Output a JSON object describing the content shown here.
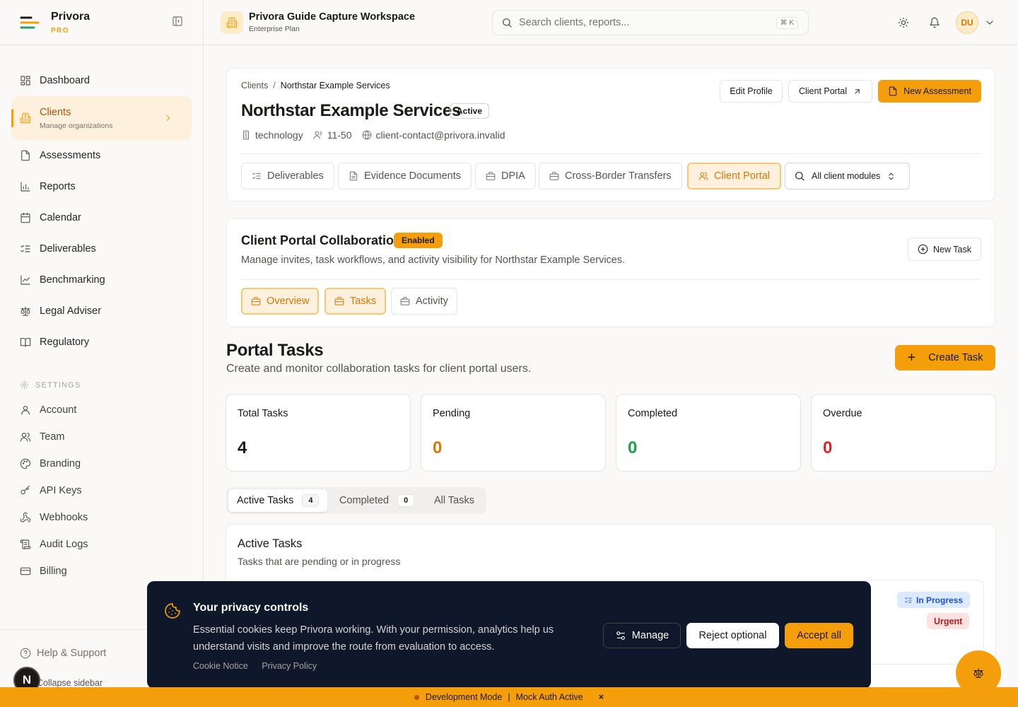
{
  "app": {
    "name": "Privora",
    "tier": "PRO"
  },
  "sidebar": {
    "items": [
      {
        "label": "Dashboard"
      },
      {
        "label": "Clients",
        "sub": "Manage organizations"
      },
      {
        "label": "Assessments"
      },
      {
        "label": "Reports"
      },
      {
        "label": "Calendar"
      },
      {
        "label": "Deliverables"
      },
      {
        "label": "Benchmarking"
      },
      {
        "label": "Legal Adviser"
      },
      {
        "label": "Regulatory"
      }
    ],
    "settings_heading": "SETTINGS",
    "settings": [
      {
        "label": "Account"
      },
      {
        "label": "Team"
      },
      {
        "label": "Branding"
      },
      {
        "label": "API Keys"
      },
      {
        "label": "Webhooks"
      },
      {
        "label": "Audit Logs"
      },
      {
        "label": "Billing"
      }
    ],
    "help": "Help & Support",
    "collapse": "Collapse sidebar",
    "n_badge": "N"
  },
  "topbar": {
    "workspace": "Privora Guide Capture Workspace",
    "plan": "Enterprise Plan",
    "search_placeholder": "Search clients, reports...",
    "shortcut": "⌘ K",
    "avatar": "DU"
  },
  "client": {
    "breadcrumb": [
      "Clients",
      "/",
      "Northstar Example Services"
    ],
    "name": "Northstar Example Services",
    "status": "Active",
    "industry": "technology",
    "size": "11-50",
    "email": "client-contact@privora.invalid",
    "buttons": {
      "edit": "Edit Profile",
      "portal": "Client Portal",
      "new_assessment": "New Assessment"
    },
    "tabs": [
      "Deliverables",
      "Evidence Documents",
      "DPIA",
      "Cross-Border Transfers",
      "Client Portal"
    ],
    "module_select": "All client modules"
  },
  "collab": {
    "title": "Client Portal Collaboration",
    "badge": "Enabled",
    "description": "Manage invites, task workflows, and activity visibility for Northstar Example Services.",
    "new_task": "New Task",
    "tabs": [
      "Overview",
      "Tasks",
      "Activity"
    ]
  },
  "portal_tasks": {
    "title": "Portal Tasks",
    "subtitle": "Create and monitor collaboration tasks for client portal users.",
    "create": "Create Task",
    "stats": [
      {
        "label": "Total Tasks",
        "value": "4",
        "color": "#1c1917"
      },
      {
        "label": "Pending",
        "value": "0",
        "color": "#d97706"
      },
      {
        "label": "Completed",
        "value": "0",
        "color": "#16a34a"
      },
      {
        "label": "Overdue",
        "value": "0",
        "color": "#dc2626"
      }
    ],
    "segments": [
      {
        "label": "Active Tasks",
        "count": "4"
      },
      {
        "label": "Completed",
        "count": "0"
      },
      {
        "label": "All Tasks"
      }
    ],
    "active_title": "Active Tasks",
    "active_sub": "Tasks that are pending or in progress",
    "status_badge": "In Progress",
    "priority_badge": "Urgent"
  },
  "cookie": {
    "title": "Your privacy controls",
    "text": "Essential cookies keep Privora working. With your permission, analytics help us understand visits and improve the route from evaluation to access.",
    "links": [
      "Cookie Notice",
      "Privacy Policy"
    ],
    "manage": "Manage",
    "reject": "Reject optional",
    "accept": "Accept all"
  },
  "devbar": {
    "mode": "Development Mode",
    "pipe": "|",
    "auth": "Mock Auth Active",
    "close": "×"
  }
}
